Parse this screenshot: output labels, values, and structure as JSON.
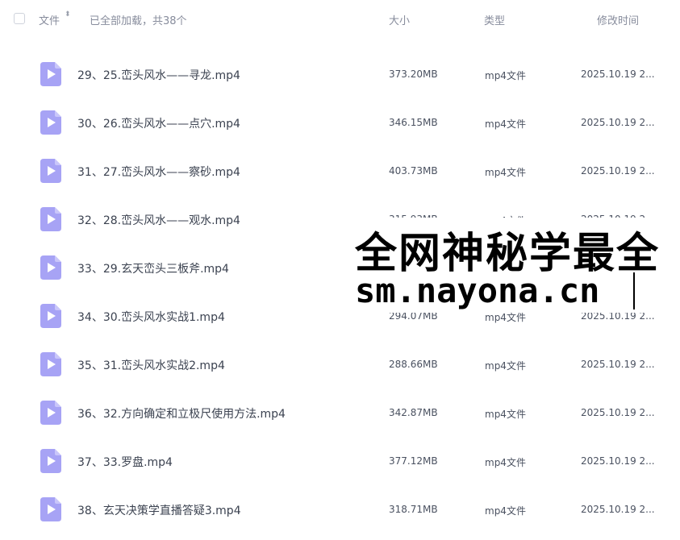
{
  "header": {
    "file_label": "文件",
    "sort_icon": "⬍",
    "summary": "已全部加载，共38个",
    "size_label": "大小",
    "type_label": "类型",
    "time_label": "修改时间"
  },
  "icon": "play-file-icon",
  "colors": {
    "icon_bg": "#a7a3f5",
    "icon_fold": "#c9c6fa"
  },
  "rows": [
    {
      "name": "29、25.峦头风水——寻龙.mp4",
      "size": "373.20MB",
      "type": "mp4文件",
      "time": "2025.10.19 2..."
    },
    {
      "name": "30、26.峦头风水——点穴.mp4",
      "size": "346.15MB",
      "type": "mp4文件",
      "time": "2025.10.19 2..."
    },
    {
      "name": "31、27.峦头风水——察砂.mp4",
      "size": "403.73MB",
      "type": "mp4文件",
      "time": "2025.10.19 2..."
    },
    {
      "name": "32、28.峦头风水——观水.mp4",
      "size": "315.93MB",
      "type": "mp4文件",
      "time": "2025.10.19 2..."
    },
    {
      "name": "33、29.玄天峦头三板斧.mp4",
      "size": "",
      "type": "",
      "time": ""
    },
    {
      "name": "34、30.峦头风水实战1.mp4",
      "size": "294.07MB",
      "type": "mp4文件",
      "time": "2025.10.19 2..."
    },
    {
      "name": "35、31.峦头风水实战2.mp4",
      "size": "288.66MB",
      "type": "mp4文件",
      "time": "2025.10.19 2..."
    },
    {
      "name": "36、32.方向确定和立极尺使用方法.mp4",
      "size": "342.87MB",
      "type": "mp4文件",
      "time": "2025.10.19 2..."
    },
    {
      "name": "37、33.罗盘.mp4",
      "size": "377.12MB",
      "type": "mp4文件",
      "time": "2025.10.19 2..."
    },
    {
      "name": "38、玄天决策学直播答疑3.mp4",
      "size": "318.71MB",
      "type": "mp4文件",
      "time": "2025.10.19 2..."
    }
  ],
  "watermark": {
    "line1": "全网神秘学最全",
    "line2": "sm.nayona.cn"
  }
}
